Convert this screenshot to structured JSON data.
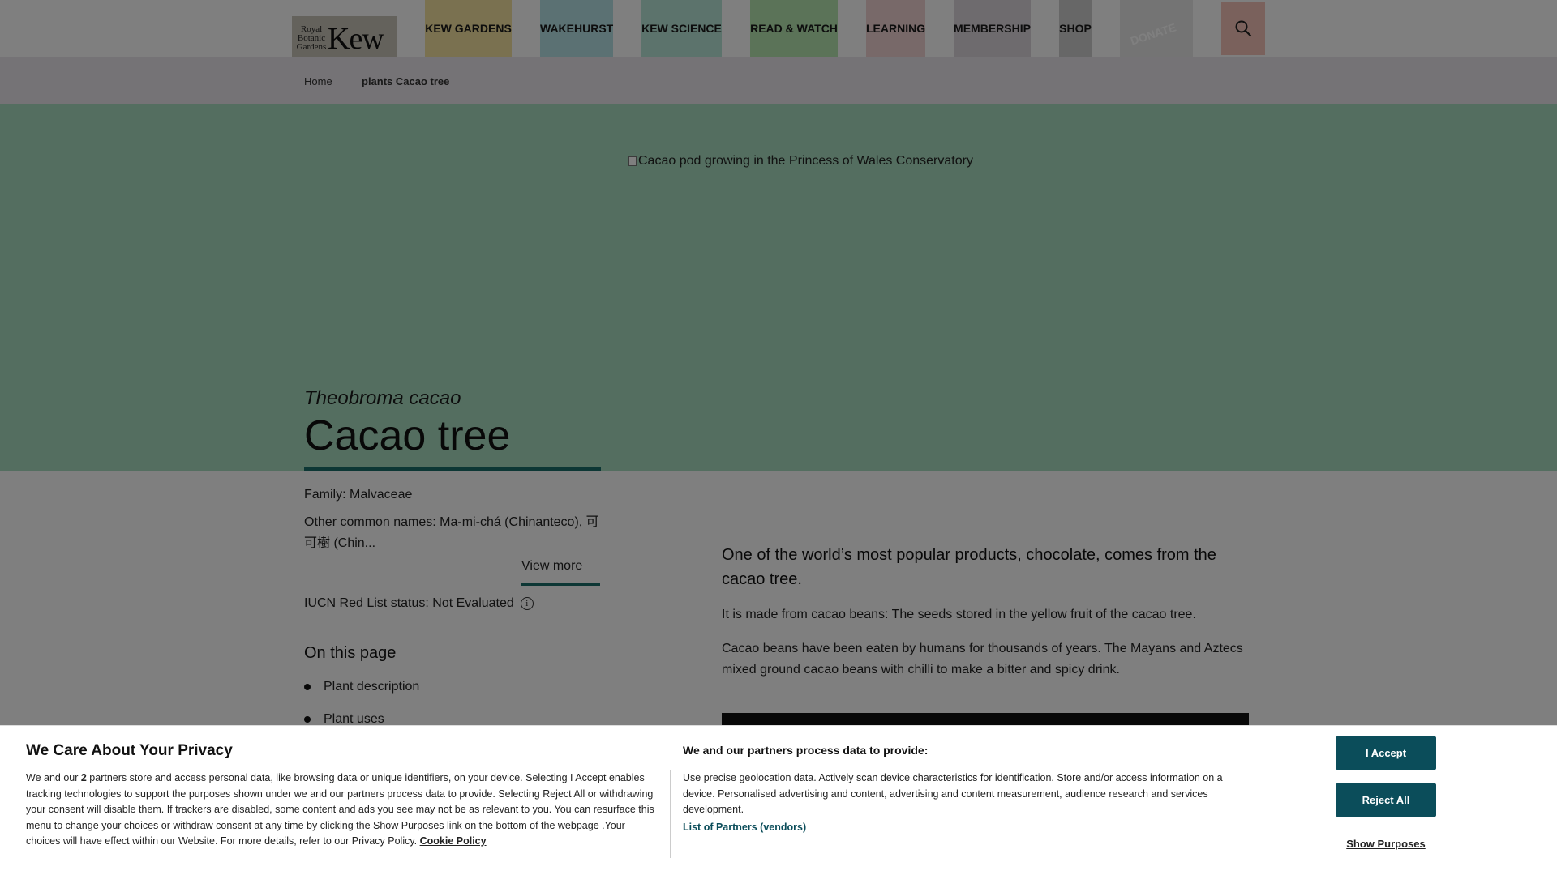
{
  "header": {
    "logo_small": "Royal Botanic Gardens",
    "logo_big": "Kew",
    "nav": [
      {
        "label": "KEW GARDENS",
        "color": "#f4e3a0"
      },
      {
        "label": "WAKEHURST",
        "color": "#b7e3e6"
      },
      {
        "label": "KEW SCIENCE",
        "color": "#b9e6d8"
      },
      {
        "label": "READ & WATCH",
        "color": "#b6e7b1"
      },
      {
        "label": "LEARNING",
        "color": "#f1d2d2"
      },
      {
        "label": "MEMBERSHIP",
        "color": "#ddd6dc"
      },
      {
        "label": "SHOP",
        "color": "#cfcfcf"
      }
    ],
    "donate_label": "DONATE",
    "search_icon": "search-icon"
  },
  "breadcrumb": {
    "home": "Home",
    "current": "plants Cacao tree"
  },
  "hero": {
    "image_alt": "Cacao pod growing in the Princess of Wales Conservatory",
    "latin_name": "Theobroma cacao",
    "title": "Cacao tree"
  },
  "meta": {
    "family": "Family: Malvaceae",
    "other_names": "Other common names: Ma-mi-chá (Chinanteco), 可可樹 (Chin...",
    "view_more": "View more",
    "iucn": "IUCN Red List status: Not Evaluated"
  },
  "on_this_page": {
    "title": "On this page",
    "items": [
      "Plant description",
      "Plant uses"
    ]
  },
  "article": {
    "lead": "One of the world’s most popular products, chocolate, comes from the cacao tree.",
    "p1": "It is made from cacao beans: The seeds stored in the yellow fruit of the cacao tree.",
    "p2": "Cacao beans have been eaten by humans for thousands of years. The Mayans and Aztecs mixed ground cacao beans with chilli to make a bitter and spicy drink."
  },
  "cookie": {
    "title": "We Care About Your Privacy",
    "text_pre": "We and our ",
    "partner_count": "2",
    "text_body": " partners store and access personal data, like browsing data or unique identifiers, on your device. Selecting I Accept enables tracking technologies to support the purposes shown under we and our partners process data to provide. Selecting Reject All or withdrawing your consent will disable them. If trackers are disabled, some content and ads you see may not be as relevant to you. You can resurface this menu to change your choices or withdraw consent at any time by clicking the Show Purposes link on the bottom of the webpage .Your choices will have effect within our Website. For more details, refer to our Privacy Policy. ",
    "policy_link": "Cookie Policy",
    "purposes_title": "We and our partners process data to provide:",
    "purposes_text": "Use precise geolocation data. Actively scan device characteristics for identification. Store and/or access information on a device. Personalised advertising and content, advertising and content measurement, audience research and services development.",
    "partners_link": "List of Partners (vendors)",
    "accept": "I Accept",
    "reject": "Reject All",
    "show_purposes": "Show Purposes"
  }
}
